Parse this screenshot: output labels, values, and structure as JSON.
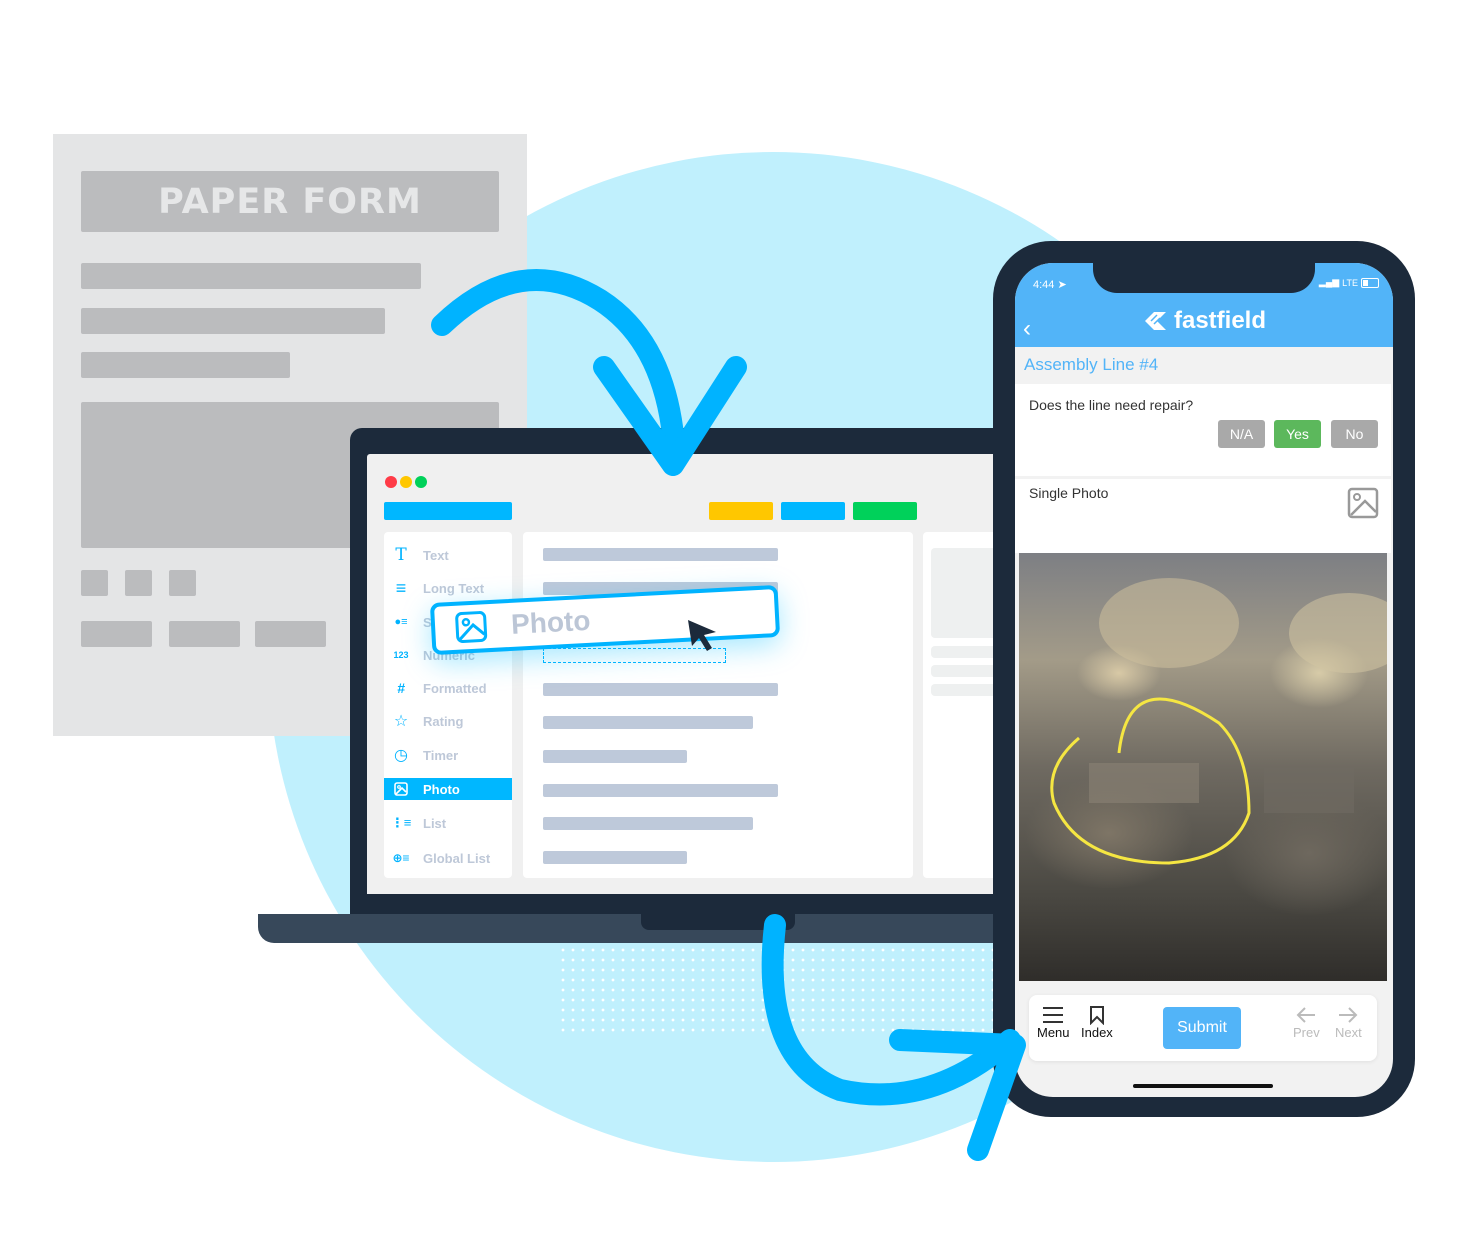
{
  "paper_form": {
    "title": "PAPER FORM"
  },
  "builder": {
    "window_controls": [
      "close",
      "minimize",
      "maximize"
    ],
    "colors": {
      "accent": "#00b7ff",
      "yellow": "#ffc700",
      "green": "#00d15a",
      "red": "#ff3b47",
      "placeholder_bar": "#bec9da"
    },
    "sidebar": {
      "items": [
        {
          "label": "Text",
          "icon": "text-type-icon",
          "glyph": "T"
        },
        {
          "label": "Long Text",
          "icon": "long-text-icon",
          "glyph": "≡"
        },
        {
          "label": "Single",
          "icon": "single-select-icon",
          "glyph": "●≡"
        },
        {
          "label": "Numeric",
          "icon": "numeric-icon",
          "glyph": "123"
        },
        {
          "label": "Formatted",
          "icon": "hash-icon",
          "glyph": "#"
        },
        {
          "label": "Rating",
          "icon": "star-icon",
          "glyph": "☆"
        },
        {
          "label": "Timer",
          "icon": "timer-icon",
          "glyph": "◷"
        },
        {
          "label": "Photo",
          "icon": "photo-icon",
          "glyph": "▨",
          "active": true
        },
        {
          "label": "List",
          "icon": "list-icon",
          "glyph": "⋮≡"
        },
        {
          "label": "Global List",
          "icon": "global-list-icon",
          "glyph": "⊕≡"
        }
      ]
    },
    "drag_chip": {
      "label": "Photo",
      "icon": "photo-icon"
    }
  },
  "phone": {
    "status": {
      "time": "4:44",
      "network": "LTE"
    },
    "app_name": "fastfield",
    "form_name": "Assembly Line #4",
    "questions": [
      {
        "label": "Does the line need repair?",
        "options": [
          "N/A",
          "Yes",
          "No"
        ],
        "selected": "Yes"
      },
      {
        "label": "Single Photo"
      }
    ],
    "bottom_bar": {
      "menu": "Menu",
      "index": "Index",
      "submit": "Submit",
      "prev": "Prev",
      "next": "Next"
    },
    "colors": {
      "header": "#52b4f8",
      "selected_option": "#5cb85c",
      "option": "#a9a9a9",
      "annotation_circle": "#f5e642"
    }
  }
}
